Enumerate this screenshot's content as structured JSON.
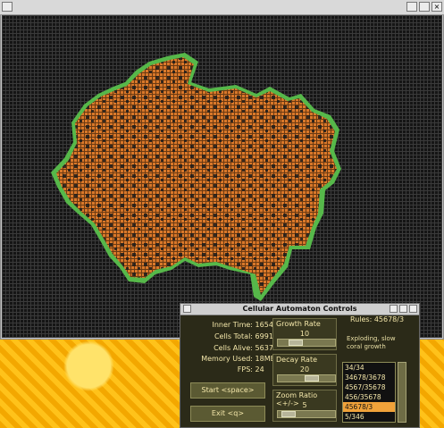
{
  "window": {
    "title": ""
  },
  "panel": {
    "title": "Cellular Automaton Controls",
    "stats": [
      {
        "key": "Inner Time:",
        "value": "1654"
      },
      {
        "key": "Cells Total:",
        "value": "6991"
      },
      {
        "key": "Cells Alive:",
        "value": "5637"
      },
      {
        "key": "Memory Used:",
        "value": "18MB"
      },
      {
        "key": "FPS:",
        "value": "24"
      }
    ],
    "start_label": "Start <space>",
    "exit_label": "Exit <q>",
    "growth": {
      "label": "Growth Rate",
      "value": "10"
    },
    "decay": {
      "label": "Decay Rate",
      "value": "20"
    },
    "zoom": {
      "label": "Zoom Ratio <+/->",
      "value": "5"
    },
    "rules_title": "Rules: 45678/3",
    "rules_desc": "Exploding, slow coral growth",
    "rules_list": [
      "34/34",
      "34678/3678",
      "4567/35678",
      "456/35678",
      "45678/3",
      "5/346"
    ],
    "selected_index": 4
  }
}
